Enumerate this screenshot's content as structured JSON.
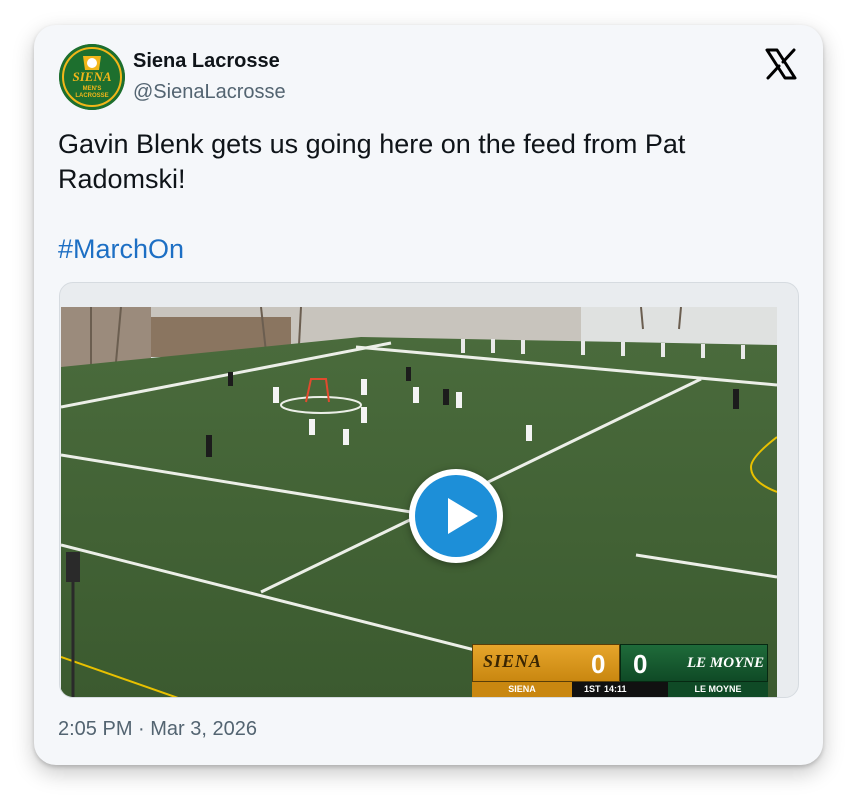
{
  "author": {
    "name": "Siena Lacrosse",
    "handle": "@SienaLacrosse",
    "avatar_text": {
      "line1": "SIENA",
      "line2": "MEN'S",
      "line3": "LACROSSE"
    }
  },
  "platform_icon": "x-logo-icon",
  "tweet": {
    "text": "Gavin Blenk gets us going here on the feed from Pat Radomski!",
    "hashtag": "#MarchOn"
  },
  "video": {
    "play_icon": "play-icon",
    "scoreboard": {
      "home_name": "SIENA",
      "home_score": "0",
      "home_label": "SIENA",
      "away_score": "0",
      "away_name": "LE MOYNE",
      "away_label": "LE MOYNE",
      "period": "1ST",
      "clock": "14:11"
    }
  },
  "timestamp": "2:05 PM · Mar 3, 2026",
  "colors": {
    "name": "#0f1419",
    "secondary": "#536471",
    "link": "#1d6fc4",
    "play": "#1d8fd8",
    "siena_gold": "#e6a52b",
    "siena_green": "#1d6f2e",
    "lemoyne_green": "#1f6b3a"
  }
}
